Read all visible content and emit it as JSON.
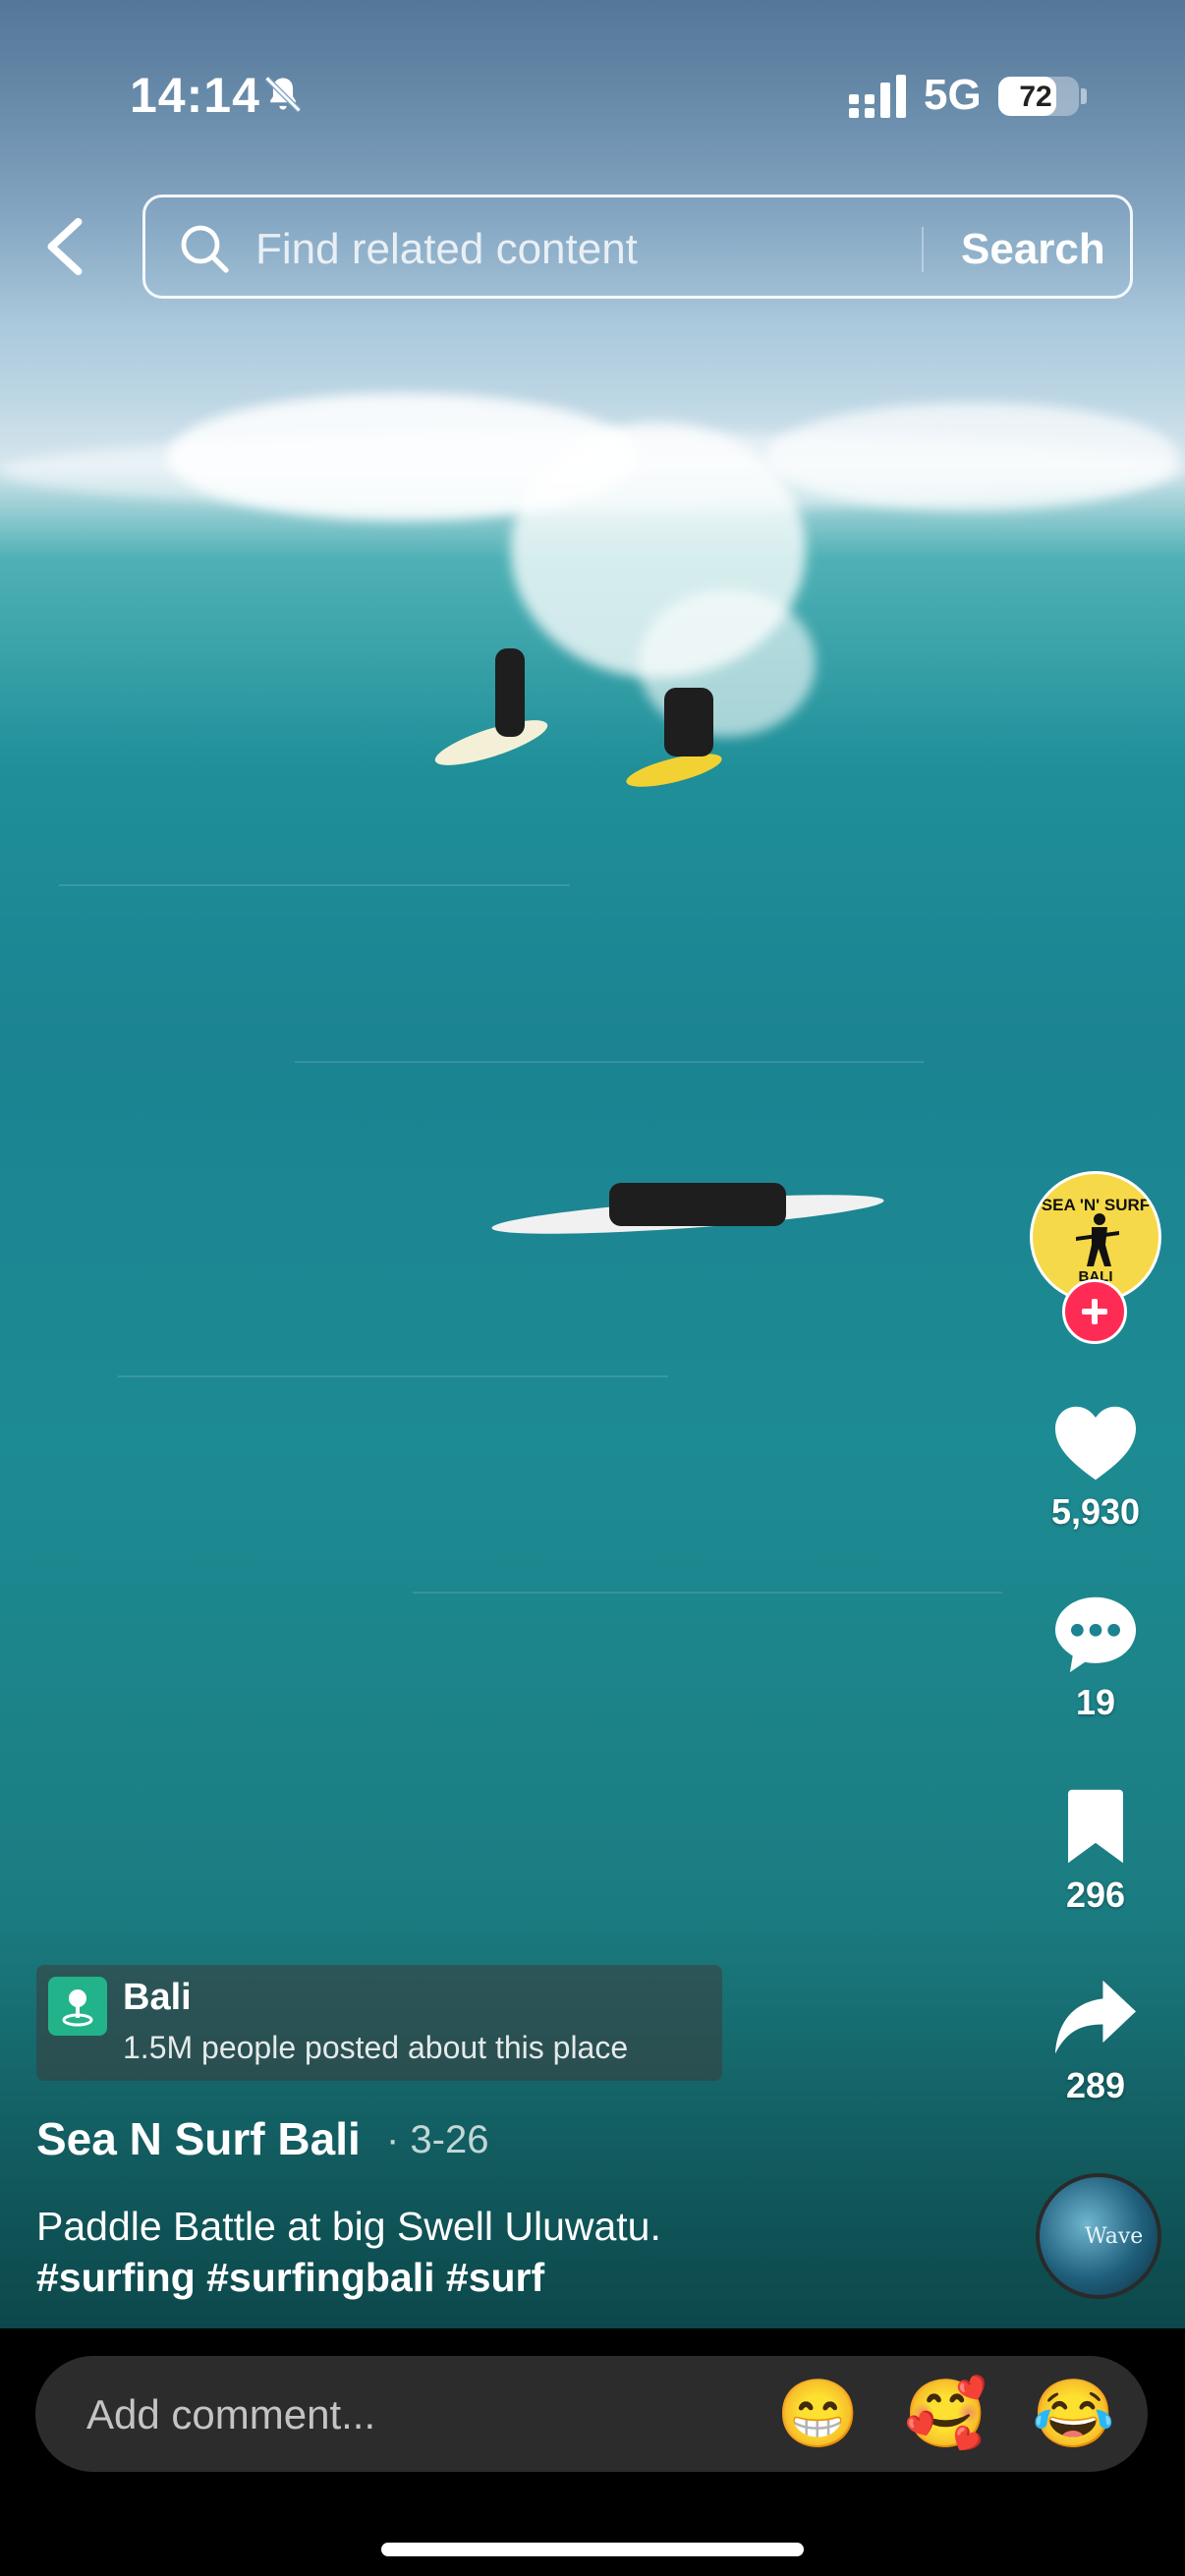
{
  "status_bar": {
    "time": "14:14",
    "network": "5G",
    "battery": "72",
    "battery_level": 0.72
  },
  "header": {
    "search_placeholder": "Find related content",
    "search_button": "Search"
  },
  "creator": {
    "avatar_text_top": "SEA 'N' SURF",
    "avatar_text_bottom": "BALI"
  },
  "actions": {
    "likes": "5,930",
    "comments": "19",
    "saves": "296",
    "shares": "289"
  },
  "music": {
    "disc_label": "Wave"
  },
  "location": {
    "name": "Bali",
    "subtitle": "1.5M people posted about this place"
  },
  "post": {
    "author": "Sea N Surf Bali",
    "date": "· 3-26",
    "caption": "Paddle Battle at big Swell Uluwatu.",
    "hashtags": "#surfing #surfingbali #surf"
  },
  "comment_bar": {
    "placeholder": "Add comment...",
    "emojis": [
      "😁",
      "🥰",
      "😂"
    ]
  },
  "colors": {
    "accent": "#fe2c55",
    "location_icon": "#22b38a",
    "avatar_bg": "#f6d948"
  }
}
